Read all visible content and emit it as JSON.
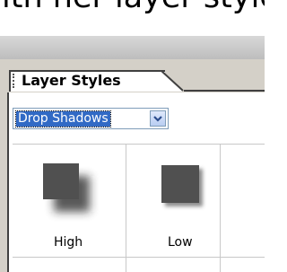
{
  "caption": {
    "text": "ith her layer style p"
  },
  "palette": {
    "tab_label": "Layer Styles",
    "style_set_select": {
      "value": "Drop Shadows"
    },
    "presets": [
      {
        "label": "High"
      },
      {
        "label": "Low"
      }
    ]
  },
  "colors": {
    "panel_bg": "#d4d0c8",
    "content_bg": "#ffffff",
    "selection": "#316ac5",
    "swatch_square": "#505050"
  },
  "icons": [
    "grip-icon",
    "chevron-down-icon",
    "drop-shadow-high-icon",
    "drop-shadow-low-icon"
  ]
}
